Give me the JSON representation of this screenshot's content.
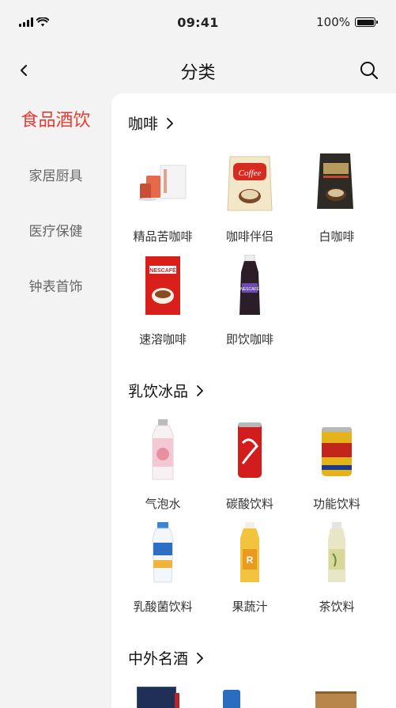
{
  "status_bar": {
    "time": "09:41",
    "battery": "100%"
  },
  "nav": {
    "title": "分类"
  },
  "sidebar": {
    "items": [
      {
        "label": "食品酒饮",
        "active": true
      },
      {
        "label": "家居厨具"
      },
      {
        "label": "医疗保健"
      },
      {
        "label": "钟表首饰"
      }
    ]
  },
  "sections": [
    {
      "title": "咖啡",
      "products": [
        {
          "label": "精品苦咖啡",
          "icon": "coffee-capsule-set-icon"
        },
        {
          "label": "咖啡伴侣",
          "icon": "coffee-mate-bag-icon"
        },
        {
          "label": "白咖啡",
          "icon": "white-coffee-bag-icon"
        },
        {
          "label": "速溶咖啡",
          "icon": "nescafe-box-icon"
        },
        {
          "label": "即饮咖啡",
          "icon": "coffee-bottle-icon"
        }
      ]
    },
    {
      "title": "乳饮冰品",
      "products": [
        {
          "label": "气泡水",
          "icon": "sparkling-water-bottle-icon"
        },
        {
          "label": "碳酸饮料",
          "icon": "cola-can-icon"
        },
        {
          "label": "功能饮料",
          "icon": "energy-drink-can-icon"
        },
        {
          "label": "乳酸菌饮料",
          "icon": "yogurt-drink-bottle-icon"
        },
        {
          "label": "果蔬汁",
          "icon": "juice-bottle-icon"
        },
        {
          "label": "茶饮料",
          "icon": "tea-bottle-icon"
        }
      ]
    },
    {
      "title": "中外名酒",
      "products": []
    }
  ],
  "colors": {
    "accent": "#e83a32",
    "sidebar_bg": "#f3f3f3",
    "content_bg": "#ffffff"
  }
}
